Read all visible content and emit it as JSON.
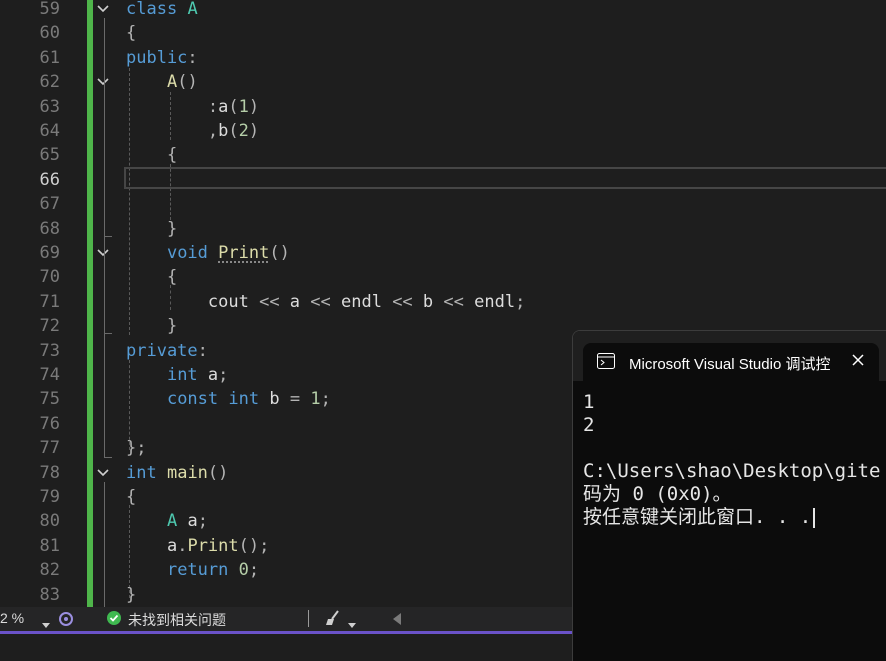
{
  "editor": {
    "line_numbers": [
      "59",
      "60",
      "61",
      "62",
      "63",
      "64",
      "65",
      "66",
      "67",
      "68",
      "69",
      "70",
      "71",
      "72",
      "73",
      "74",
      "75",
      "76",
      "77",
      "78",
      "79",
      "80",
      "81",
      "82",
      "83"
    ],
    "current_line": "66",
    "lines": [
      [
        {
          "t": "class",
          "c": "kw"
        },
        {
          "t": " "
        },
        {
          "t": "A",
          "c": "cls"
        }
      ],
      [
        {
          "t": "{",
          "c": "pu"
        }
      ],
      [
        {
          "t": "public",
          "c": "kw"
        },
        {
          "t": ":",
          "c": "pu"
        }
      ],
      [
        {
          "t": "    "
        },
        {
          "t": "A",
          "c": "fn"
        },
        {
          "t": "()",
          "c": "pu"
        }
      ],
      [
        {
          "t": "        "
        },
        {
          "t": ":",
          "c": "pu"
        },
        {
          "t": "a",
          "c": "id"
        },
        {
          "t": "(",
          "c": "pu"
        },
        {
          "t": "1",
          "c": "num"
        },
        {
          "t": ")",
          "c": "pu"
        }
      ],
      [
        {
          "t": "        "
        },
        {
          "t": ",",
          "c": "pu"
        },
        {
          "t": "b",
          "c": "id"
        },
        {
          "t": "(",
          "c": "pu"
        },
        {
          "t": "2",
          "c": "num"
        },
        {
          "t": ")",
          "c": "pu"
        }
      ],
      [
        {
          "t": "    "
        },
        {
          "t": "{",
          "c": "pu"
        }
      ],
      [
        {
          "t": ""
        }
      ],
      [
        {
          "t": ""
        }
      ],
      [
        {
          "t": "    "
        },
        {
          "t": "}",
          "c": "pu"
        }
      ],
      [
        {
          "t": "    "
        },
        {
          "t": "void",
          "c": "kw"
        },
        {
          "t": " "
        },
        {
          "t": "Print",
          "c": "fn squig"
        },
        {
          "t": "()",
          "c": "pu"
        }
      ],
      [
        {
          "t": "    "
        },
        {
          "t": "{",
          "c": "pu"
        }
      ],
      [
        {
          "t": "        "
        },
        {
          "t": "cout",
          "c": "id"
        },
        {
          "t": " << ",
          "c": "pu"
        },
        {
          "t": "a",
          "c": "id"
        },
        {
          "t": " << ",
          "c": "pu"
        },
        {
          "t": "endl",
          "c": "id"
        },
        {
          "t": " << ",
          "c": "pu"
        },
        {
          "t": "b",
          "c": "id"
        },
        {
          "t": " << ",
          "c": "pu"
        },
        {
          "t": "endl",
          "c": "id"
        },
        {
          "t": ";",
          "c": "pu"
        }
      ],
      [
        {
          "t": "    "
        },
        {
          "t": "}",
          "c": "pu"
        }
      ],
      [
        {
          "t": "private",
          "c": "kw"
        },
        {
          "t": ":",
          "c": "pu"
        }
      ],
      [
        {
          "t": "    "
        },
        {
          "t": "int",
          "c": "kw"
        },
        {
          "t": " "
        },
        {
          "t": "a",
          "c": "id"
        },
        {
          "t": ";",
          "c": "pu"
        }
      ],
      [
        {
          "t": "    "
        },
        {
          "t": "const",
          "c": "kw"
        },
        {
          "t": " "
        },
        {
          "t": "int",
          "c": "kw"
        },
        {
          "t": " "
        },
        {
          "t": "b",
          "c": "id"
        },
        {
          "t": " = ",
          "c": "pu"
        },
        {
          "t": "1",
          "c": "num"
        },
        {
          "t": ";",
          "c": "pu"
        }
      ],
      [
        {
          "t": ""
        }
      ],
      [
        {
          "t": "};",
          "c": "pu"
        }
      ],
      [
        {
          "t": "int",
          "c": "kw"
        },
        {
          "t": " "
        },
        {
          "t": "main",
          "c": "fn"
        },
        {
          "t": "()",
          "c": "pu"
        }
      ],
      [
        {
          "t": "{",
          "c": "pu"
        }
      ],
      [
        {
          "t": "    "
        },
        {
          "t": "A",
          "c": "cls"
        },
        {
          "t": " "
        },
        {
          "t": "a",
          "c": "id"
        },
        {
          "t": ";",
          "c": "pu"
        }
      ],
      [
        {
          "t": "    "
        },
        {
          "t": "a",
          "c": "id"
        },
        {
          "t": ".",
          "c": "pu"
        },
        {
          "t": "Print",
          "c": "fn"
        },
        {
          "t": "();",
          "c": "pu"
        }
      ],
      [
        {
          "t": "    "
        },
        {
          "t": "return",
          "c": "kw"
        },
        {
          "t": " "
        },
        {
          "t": "0",
          "c": "num"
        },
        {
          "t": ";",
          "c": "pu"
        }
      ],
      [
        {
          "t": "}",
          "c": "pu"
        }
      ]
    ]
  },
  "statusbar": {
    "zoom": "2 %",
    "issues": "未找到相关问题"
  },
  "console": {
    "title": "Microsoft Visual Studio 调试控",
    "output_lines": [
      "1",
      "2",
      "",
      "C:\\Users\\shao\\Desktop\\gite",
      "码为 0 (0x0)。",
      "按任意键关闭此窗口. . ."
    ]
  },
  "colors": {
    "keyword": "#569cd6",
    "class": "#4ec9b0",
    "function": "#dcdcaa",
    "number": "#b5cea8",
    "change_bar": "#4fb54a",
    "status_ok": "#3fb950"
  }
}
